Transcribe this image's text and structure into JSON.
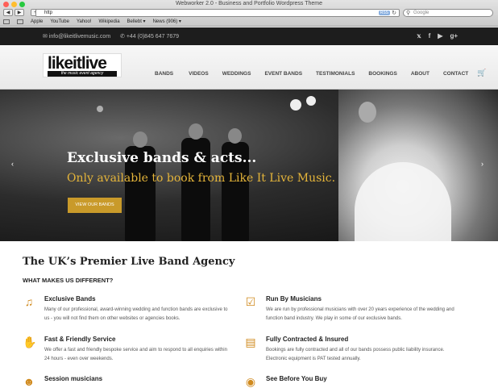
{
  "browser": {
    "window_title": "Webworker 2.0 - Business and Portfolio Wordpress Theme",
    "url": "http",
    "rss": "RSS",
    "search_placeholder": "Google",
    "bookmarks": [
      "Apple",
      "YouTube",
      "Yahoo!",
      "Wikipedia",
      "Bellebt ▾",
      "News (906) ▾"
    ]
  },
  "topbar": {
    "email": "info@likeitlivemusic.com",
    "phone": "+44 (0)845 647 7679",
    "socials": [
      "twitter-icon",
      "facebook-icon",
      "youtube-icon",
      "google-plus-icon"
    ]
  },
  "logo": {
    "word": "likeitlive",
    "tagline": "the music event agency"
  },
  "menu": [
    "BANDS",
    "VIDEOS",
    "WEDDINGS",
    "EVENT BANDS",
    "TESTIMONIALS",
    "BOOKINGS",
    "ABOUT",
    "CONTACT"
  ],
  "hero": {
    "headline": "Exclusive bands & acts...",
    "subline": "Only available to book from Like It Live Music.",
    "button": "VIEW OUR BANDS"
  },
  "main": {
    "title": "The UK’s Premier Live Band Agency",
    "subtitle": "WHAT MAKES US DIFFERENT?",
    "features": [
      {
        "icon": "music-note-icon",
        "title": "Exclusive Bands",
        "text": "Many of our professional, award-winning wedding and function bands are exclusive to us - you will not find them on other websites or agencies books."
      },
      {
        "icon": "checkbox-icon",
        "title": "Run By Musicians",
        "text": "We are run by professional musicians with over 20 years experience of the wedding and function band industry. We play in some of our exclusive bands."
      },
      {
        "icon": "thumbs-up-icon",
        "title": "Fast & Friendly Service",
        "text": "We offer a fast and friendly bespoke service and aim to respond to all enquiries within 24 hours - even over weekends."
      },
      {
        "icon": "document-icon",
        "title": "Fully Contracted & Insured",
        "text": "Bookings are fully contracted and all of our bands possess public liability insurance. Electronic equipment is PAT tested annually."
      },
      {
        "icon": "people-icon",
        "title": "Session musicians",
        "text": ""
      },
      {
        "icon": "eye-icon",
        "title": "See Before You Buy",
        "text": ""
      }
    ]
  },
  "colors": {
    "accent": "#c99a2a",
    "dark": "#1d1d1d"
  }
}
